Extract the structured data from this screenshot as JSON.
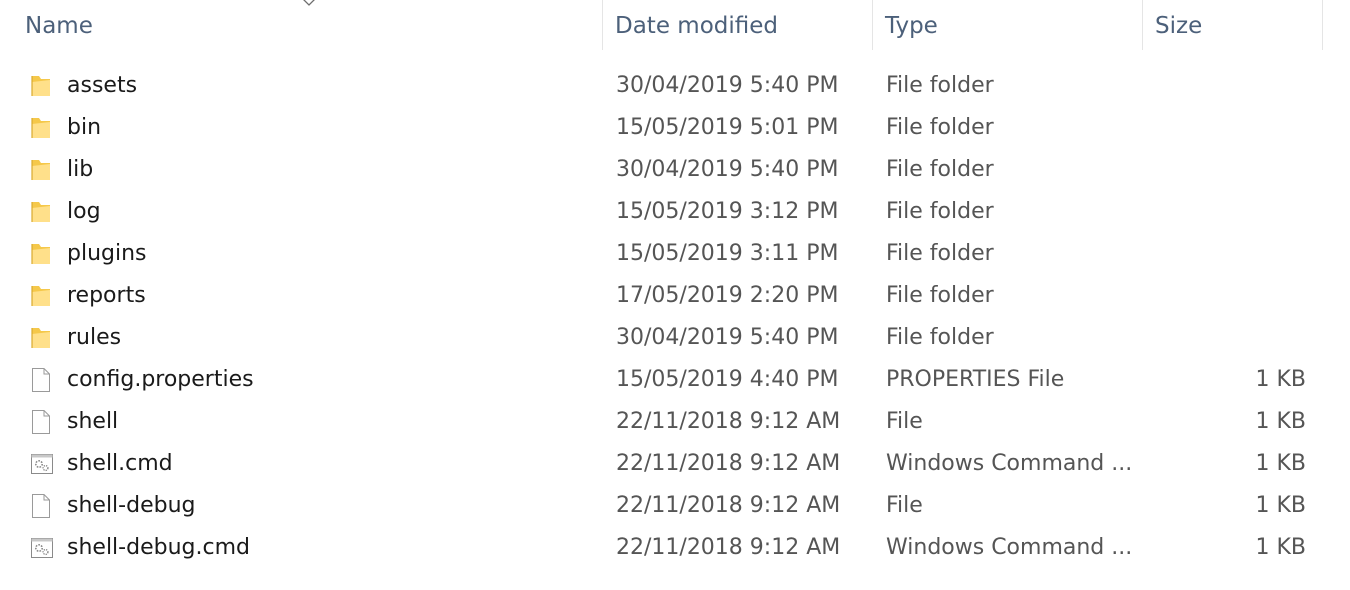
{
  "header": {
    "name": "Name",
    "date": "Date modified",
    "type": "Type",
    "size": "Size",
    "sort_indicator": "^"
  },
  "files": [
    {
      "name": "assets",
      "date": "30/04/2019 5:40 PM",
      "type": "File folder",
      "size": "",
      "icon": "folder-icon"
    },
    {
      "name": "bin",
      "date": "15/05/2019 5:01 PM",
      "type": "File folder",
      "size": "",
      "icon": "folder-icon"
    },
    {
      "name": "lib",
      "date": "30/04/2019 5:40 PM",
      "type": "File folder",
      "size": "",
      "icon": "folder-icon"
    },
    {
      "name": "log",
      "date": "15/05/2019 3:12 PM",
      "type": "File folder",
      "size": "",
      "icon": "folder-icon"
    },
    {
      "name": "plugins",
      "date": "15/05/2019 3:11 PM",
      "type": "File folder",
      "size": "",
      "icon": "folder-icon"
    },
    {
      "name": "reports",
      "date": "17/05/2019 2:20 PM",
      "type": "File folder",
      "size": "",
      "icon": "folder-icon"
    },
    {
      "name": "rules",
      "date": "30/04/2019 5:40 PM",
      "type": "File folder",
      "size": "",
      "icon": "folder-icon"
    },
    {
      "name": "config.properties",
      "date": "15/05/2019 4:40 PM",
      "type": "PROPERTIES File",
      "size": "1 KB",
      "icon": "file-icon"
    },
    {
      "name": "shell",
      "date": "22/11/2018 9:12 AM",
      "type": "File",
      "size": "1 KB",
      "icon": "file-icon"
    },
    {
      "name": "shell.cmd",
      "date": "22/11/2018 9:12 AM",
      "type": "Windows Command ...",
      "size": "1 KB",
      "icon": "cmd-file-icon"
    },
    {
      "name": "shell-debug",
      "date": "22/11/2018 9:12 AM",
      "type": "File",
      "size": "1 KB",
      "icon": "file-icon"
    },
    {
      "name": "shell-debug.cmd",
      "date": "22/11/2018 9:12 AM",
      "type": "Windows Command ...",
      "size": "1 KB",
      "icon": "cmd-file-icon"
    }
  ],
  "colors": {
    "header_text": "#4c607a",
    "folder": "#f5c84a",
    "folder_light": "#ffe08a",
    "cell_text": "#555555"
  }
}
